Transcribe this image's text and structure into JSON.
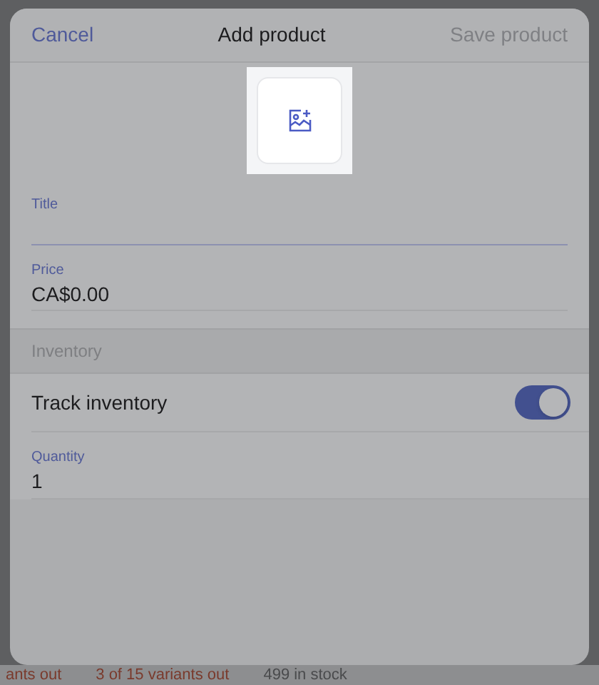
{
  "background": {
    "status_texts": [
      {
        "text": "ants out",
        "kind": "alert"
      },
      {
        "text": "3 of 15 variants out",
        "kind": "alert"
      },
      {
        "text": "499 in stock",
        "kind": "normal"
      }
    ]
  },
  "dialog": {
    "title": "Add product",
    "cancel": "Cancel",
    "save": {
      "label": "Save product",
      "disabled": true
    },
    "fields": [
      {
        "label": "Title"
      },
      {
        "label": "Price",
        "value": "CA$0.00"
      }
    ],
    "section": "Inventory",
    "track": {
      "label": "Track inventory",
      "on": true
    },
    "quantity": {
      "label": "Quantity",
      "value": "1"
    }
  }
}
